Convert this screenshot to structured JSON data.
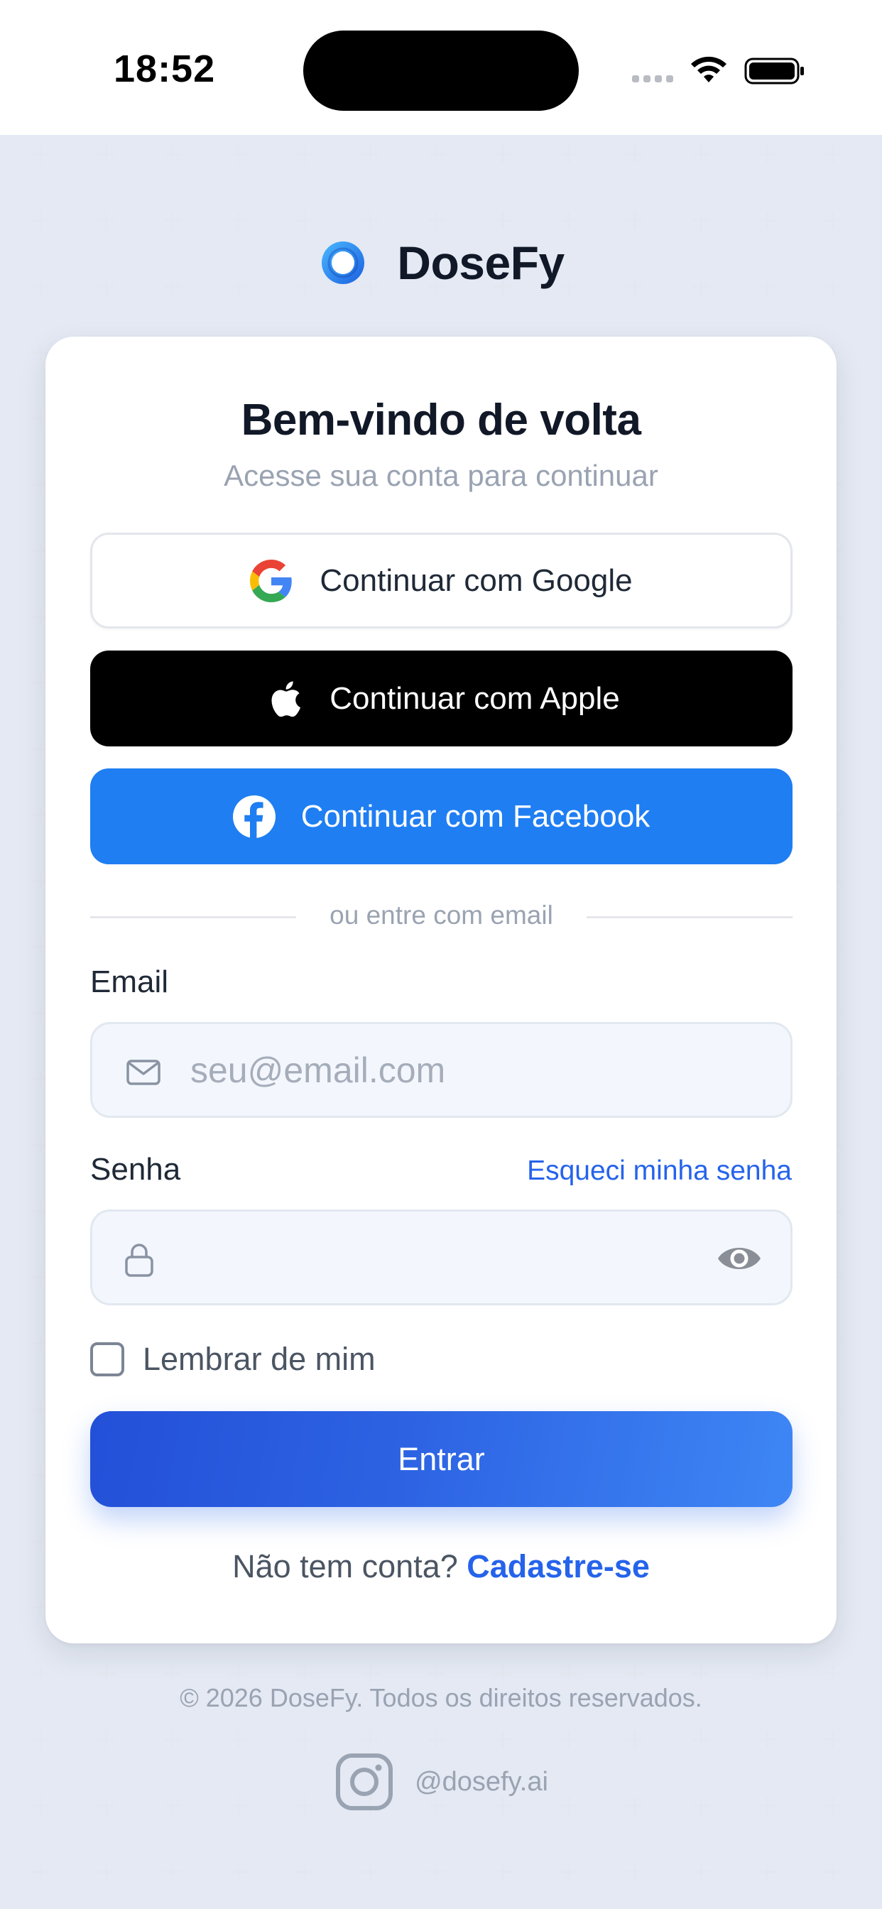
{
  "status_bar": {
    "time": "18:52"
  },
  "brand": {
    "name": "DoseFy"
  },
  "card": {
    "title": "Bem-vindo de volta",
    "subtitle": "Acesse sua conta para continuar"
  },
  "social_login": {
    "google_label": "Continuar com Google",
    "apple_label": "Continuar com Apple",
    "facebook_label": "Continuar com Facebook"
  },
  "divider_text": "ou entre com email",
  "form": {
    "email_label": "Email",
    "email_placeholder": "seu@email.com",
    "password_label": "Senha",
    "forgot_password": "Esqueci minha senha",
    "remember_me": "Lembrar de mim",
    "submit_label": "Entrar"
  },
  "signup": {
    "prompt": "Não tem conta?",
    "link": "Cadastre-se"
  },
  "footer": {
    "copyright": "© 2026 DoseFy. Todos os direitos reservados.",
    "instagram_handle": "@dosefy.ai"
  },
  "colors": {
    "primary": "#2563eb",
    "facebook": "#1f7ef2",
    "apple": "#000000",
    "background": "#f1f4fa"
  },
  "icons": [
    "google-icon",
    "apple-icon",
    "facebook-icon",
    "mail-icon",
    "lock-icon",
    "eye-icon",
    "instagram-icon",
    "wifi-icon",
    "battery-icon"
  ]
}
